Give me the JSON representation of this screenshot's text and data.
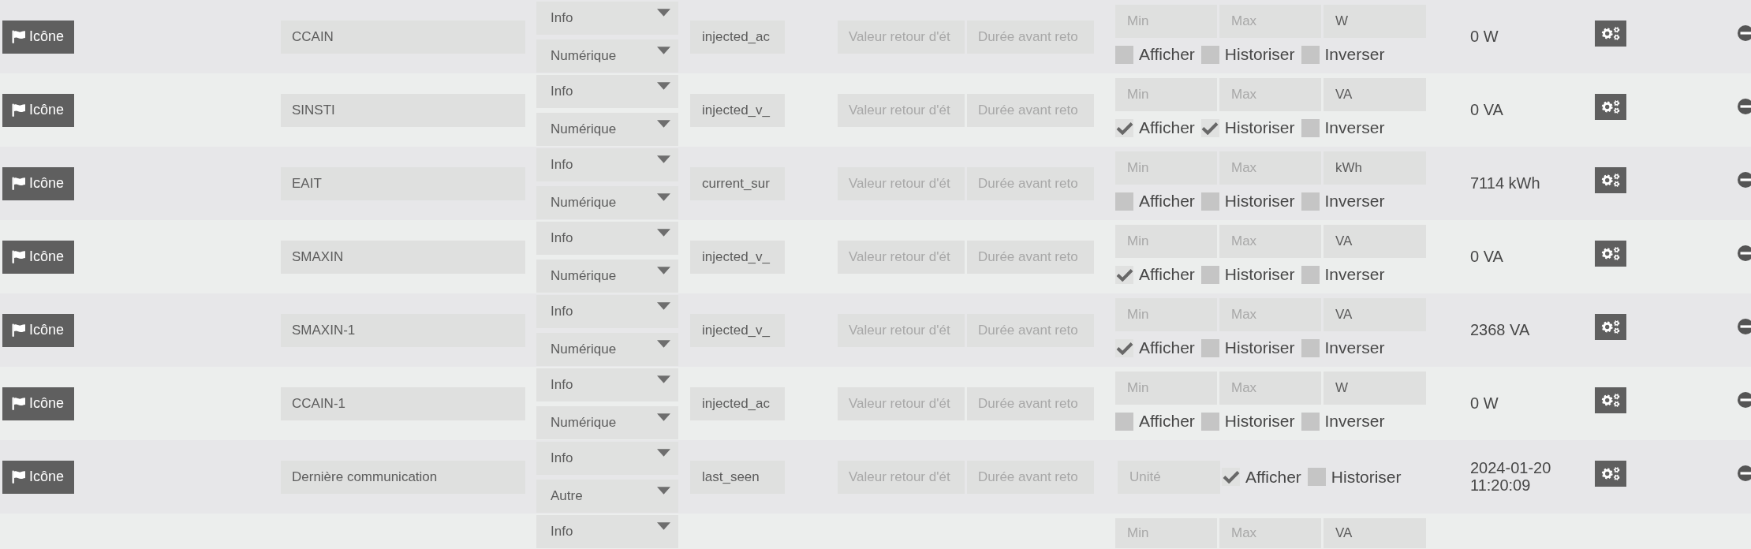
{
  "rows": [
    {
      "kind": "numeric",
      "icon_button": "Icône",
      "name": {
        "value": "CCAIN"
      },
      "type": {
        "value": "Info"
      },
      "subtype": {
        "value": "Numérique"
      },
      "logical_id": {
        "value": "injected_ac"
      },
      "return_value": {
        "placeholder": "Valeur retour d'ét"
      },
      "return_delay": {
        "placeholder": "Durée avant reto"
      },
      "min": {
        "placeholder": "Min"
      },
      "max": {
        "placeholder": "Max"
      },
      "unit": {
        "value": "W"
      },
      "options": [
        {
          "label": "Afficher",
          "checked": false
        },
        {
          "label": "Historiser",
          "checked": false
        },
        {
          "label": "Inverser",
          "checked": false
        }
      ],
      "current_value": "0 W"
    },
    {
      "kind": "numeric",
      "icon_button": "Icône",
      "name": {
        "value": "SINSTI"
      },
      "type": {
        "value": "Info"
      },
      "subtype": {
        "value": "Numérique"
      },
      "logical_id": {
        "value": "injected_v_"
      },
      "return_value": {
        "placeholder": "Valeur retour d'ét"
      },
      "return_delay": {
        "placeholder": "Durée avant reto"
      },
      "min": {
        "placeholder": "Min"
      },
      "max": {
        "placeholder": "Max"
      },
      "unit": {
        "value": "VA"
      },
      "options": [
        {
          "label": "Afficher",
          "checked": true
        },
        {
          "label": "Historiser",
          "checked": true
        },
        {
          "label": "Inverser",
          "checked": false
        }
      ],
      "current_value": "0 VA"
    },
    {
      "kind": "numeric",
      "icon_button": "Icône",
      "name": {
        "value": "EAIT"
      },
      "type": {
        "value": "Info"
      },
      "subtype": {
        "value": "Numérique"
      },
      "logical_id": {
        "value": "current_sur"
      },
      "return_value": {
        "placeholder": "Valeur retour d'ét"
      },
      "return_delay": {
        "placeholder": "Durée avant reto"
      },
      "min": {
        "placeholder": "Min"
      },
      "max": {
        "placeholder": "Max"
      },
      "unit": {
        "value": "kWh"
      },
      "options": [
        {
          "label": "Afficher",
          "checked": false
        },
        {
          "label": "Historiser",
          "checked": false
        },
        {
          "label": "Inverser",
          "checked": false
        }
      ],
      "current_value": "7114 kWh"
    },
    {
      "kind": "numeric",
      "icon_button": "Icône",
      "name": {
        "value": "SMAXIN"
      },
      "type": {
        "value": "Info"
      },
      "subtype": {
        "value": "Numérique"
      },
      "logical_id": {
        "value": "injected_v_"
      },
      "return_value": {
        "placeholder": "Valeur retour d'ét"
      },
      "return_delay": {
        "placeholder": "Durée avant reto"
      },
      "min": {
        "placeholder": "Min"
      },
      "max": {
        "placeholder": "Max"
      },
      "unit": {
        "value": "VA"
      },
      "options": [
        {
          "label": "Afficher",
          "checked": true
        },
        {
          "label": "Historiser",
          "checked": false
        },
        {
          "label": "Inverser",
          "checked": false
        }
      ],
      "current_value": "0 VA"
    },
    {
      "kind": "numeric",
      "icon_button": "Icône",
      "name": {
        "value": "SMAXIN-1"
      },
      "type": {
        "value": "Info"
      },
      "subtype": {
        "value": "Numérique"
      },
      "logical_id": {
        "value": "injected_v_"
      },
      "return_value": {
        "placeholder": "Valeur retour d'ét"
      },
      "return_delay": {
        "placeholder": "Durée avant reto"
      },
      "min": {
        "placeholder": "Min"
      },
      "max": {
        "placeholder": "Max"
      },
      "unit": {
        "value": "VA"
      },
      "options": [
        {
          "label": "Afficher",
          "checked": true
        },
        {
          "label": "Historiser",
          "checked": false
        },
        {
          "label": "Inverser",
          "checked": false
        }
      ],
      "current_value": "2368 VA"
    },
    {
      "kind": "numeric",
      "icon_button": "Icône",
      "name": {
        "value": "CCAIN-1"
      },
      "type": {
        "value": "Info"
      },
      "subtype": {
        "value": "Numérique"
      },
      "logical_id": {
        "value": "injected_ac"
      },
      "return_value": {
        "placeholder": "Valeur retour d'ét"
      },
      "return_delay": {
        "placeholder": "Durée avant reto"
      },
      "min": {
        "placeholder": "Min"
      },
      "max": {
        "placeholder": "Max"
      },
      "unit": {
        "value": "W"
      },
      "options": [
        {
          "label": "Afficher",
          "checked": false
        },
        {
          "label": "Historiser",
          "checked": false
        },
        {
          "label": "Inverser",
          "checked": false
        }
      ],
      "current_value": "0 W"
    },
    {
      "kind": "other",
      "icon_button": "Icône",
      "name": {
        "value": "Dernière communication"
      },
      "type": {
        "value": "Info"
      },
      "subtype": {
        "value": "Autre"
      },
      "logical_id": {
        "value": "last_seen"
      },
      "return_value": {
        "placeholder": "Valeur retour d'ét"
      },
      "return_delay": {
        "placeholder": "Durée avant reto"
      },
      "unit": {
        "placeholder": "Unité"
      },
      "options": [
        {
          "label": "Afficher",
          "checked": true
        },
        {
          "label": "Historiser",
          "checked": false
        }
      ],
      "current_value": "2024-01-20 11:20:09"
    }
  ],
  "partial_row": {
    "type": {
      "value": "Info"
    },
    "min": {
      "placeholder": "Min"
    },
    "max": {
      "placeholder": "Max"
    },
    "unit": {
      "value": "VA"
    }
  }
}
